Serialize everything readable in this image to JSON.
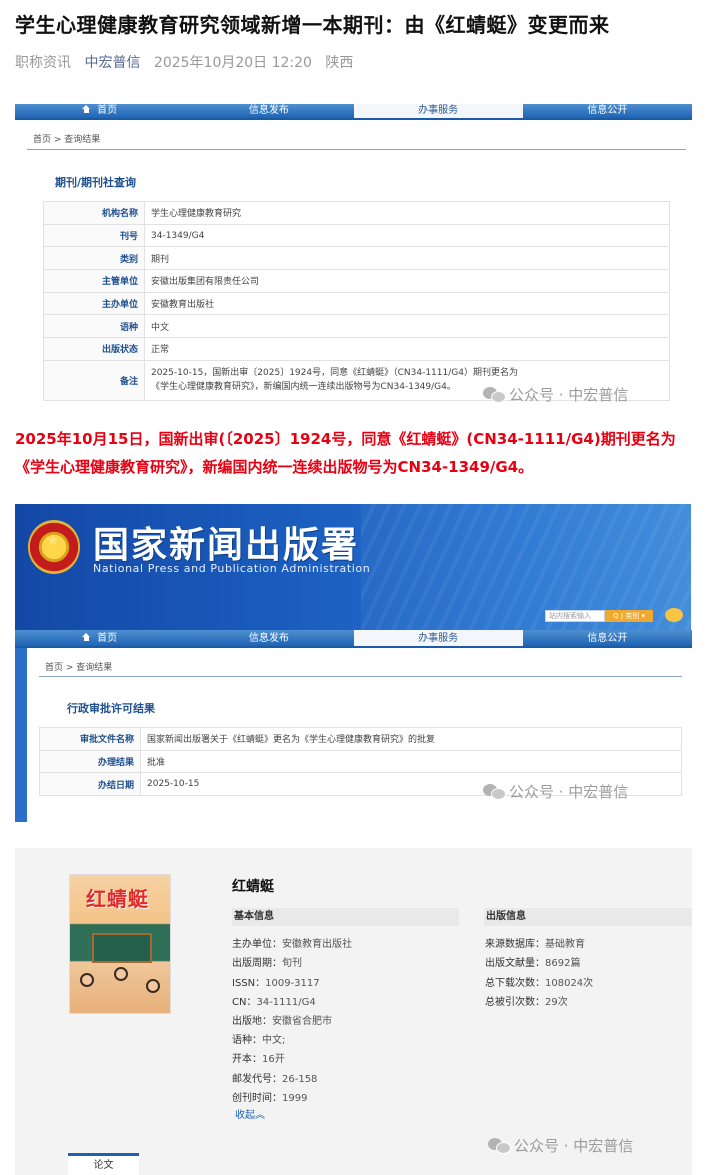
{
  "article": {
    "title": "学生心理健康教育研究领域新增一本期刊：由《红蜻蜓》变更而来",
    "meta": {
      "category": "职称资讯",
      "account": "中宏普信",
      "datetime": "2025年10月20日 12:20",
      "location": "陕西"
    }
  },
  "shot1": {
    "nav": [
      "首页",
      "信息发布",
      "办事服务",
      "信息公开"
    ],
    "breadcrumb": "首页 > 查询结果",
    "section_title": "期刊/期刊社查询",
    "rows": [
      {
        "k": "机构名称",
        "v": "学生心理健康教育研究"
      },
      {
        "k": "刊号",
        "v": "34-1349/G4"
      },
      {
        "k": "类别",
        "v": "期刊"
      },
      {
        "k": "主管单位",
        "v": "安徽出版集团有限责任公司"
      },
      {
        "k": "主办单位",
        "v": "安徽教育出版社"
      },
      {
        "k": "语种",
        "v": "中文"
      },
      {
        "k": "出版状态",
        "v": "正常"
      },
      {
        "k": "备注",
        "v": "2025-10-15，国新出审〔2025〕1924号，同意《红蜻蜓》（CN34-1111/G4）期刊更名为《学生心理健康教育研究》，新编国内统一连续出版物号为CN34-1349/G4。"
      }
    ],
    "watermark": "公众号 · 中宏普信"
  },
  "highlight": "2025年10月15日，国新出审(〔2025〕1924号，同意《红蜻蜓》(CN34-1111/G4)期刊更名为《学生心理健康教育研究》，新编国内统一连续出版物号为CN34-1349/G4。",
  "shot2": {
    "banner_cn": "国家新闻出版署",
    "banner_en": "National Press and Publication Administration",
    "search_placeholder": "站内搜索输入",
    "search_button": "Q | 类别 ▾",
    "nav": [
      "首页",
      "信息发布",
      "办事服务",
      "信息公开"
    ],
    "breadcrumb": "首页 > 查询结果",
    "section_title": "行政审批许可结果",
    "rows": [
      {
        "k": "审批文件名称",
        "v": "国家新闻出版署关于《红蜻蜓》更名为《学生心理健康教育研究》的批复"
      },
      {
        "k": "办理结果",
        "v": "批准"
      },
      {
        "k": "办结日期",
        "v": "2025-10-15"
      }
    ],
    "watermark": "公众号 · 中宏普信"
  },
  "journal": {
    "cover_title": "红蜻蜓",
    "title": "红蜻蜓",
    "basic_heading": "基本信息",
    "basic": [
      {
        "label": "主办单位：",
        "value": "安徽教育出版社"
      },
      {
        "label": "出版周期：",
        "value": "旬刊"
      },
      {
        "label": "ISSN：",
        "value": "1009-3117"
      },
      {
        "label": "CN：",
        "value": "34-1111/G4"
      },
      {
        "label": "出版地：",
        "value": "安徽省合肥市"
      },
      {
        "label": "语种：",
        "value": "中文;"
      },
      {
        "label": "开本：",
        "value": "16开"
      },
      {
        "label": "邮发代号：",
        "value": "26-158"
      },
      {
        "label": "创刊时间：",
        "value": "1999"
      }
    ],
    "collapse": "收起︽",
    "pub_heading": "出版信息",
    "pub": [
      {
        "label": "来源数据库：",
        "value": "基础教育"
      },
      {
        "label": "出版文献量：",
        "value": "8692篇"
      },
      {
        "label": "总下载次数：",
        "value": "108024次"
      },
      {
        "label": "总被引次数：",
        "value": "29次"
      }
    ],
    "tab": "论文",
    "watermark": "公众号 · 中宏普信"
  }
}
